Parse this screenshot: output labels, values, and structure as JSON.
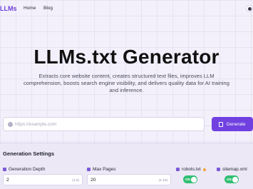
{
  "nav": {
    "logo": "LLMs",
    "links": [
      "Home",
      "Blog"
    ],
    "theme_icon": "half-moon-icon"
  },
  "hero": {
    "title": "LLMs.txt Generator",
    "description": "Extracts core website content, creates structured text files, improves LLM comprehension, boosts search engine visibility, and delivers quality data for AI training and inference."
  },
  "url_form": {
    "placeholder": "https://example.com",
    "value": "",
    "generate_label": "Generate",
    "accent": "#7040e0"
  },
  "settings": {
    "title": "Generation Settings",
    "depth": {
      "label": "Generation Depth",
      "value": "2",
      "range": "(1-3)"
    },
    "pages": {
      "label": "Max Pages",
      "value": "20",
      "range": "(1-10)"
    },
    "robots": {
      "label": "robots.txt",
      "toggle": "ON"
    },
    "sitemap": {
      "label": "sitemap.xml",
      "toggle": "ON"
    },
    "toggle_color": "#2fbf71"
  }
}
